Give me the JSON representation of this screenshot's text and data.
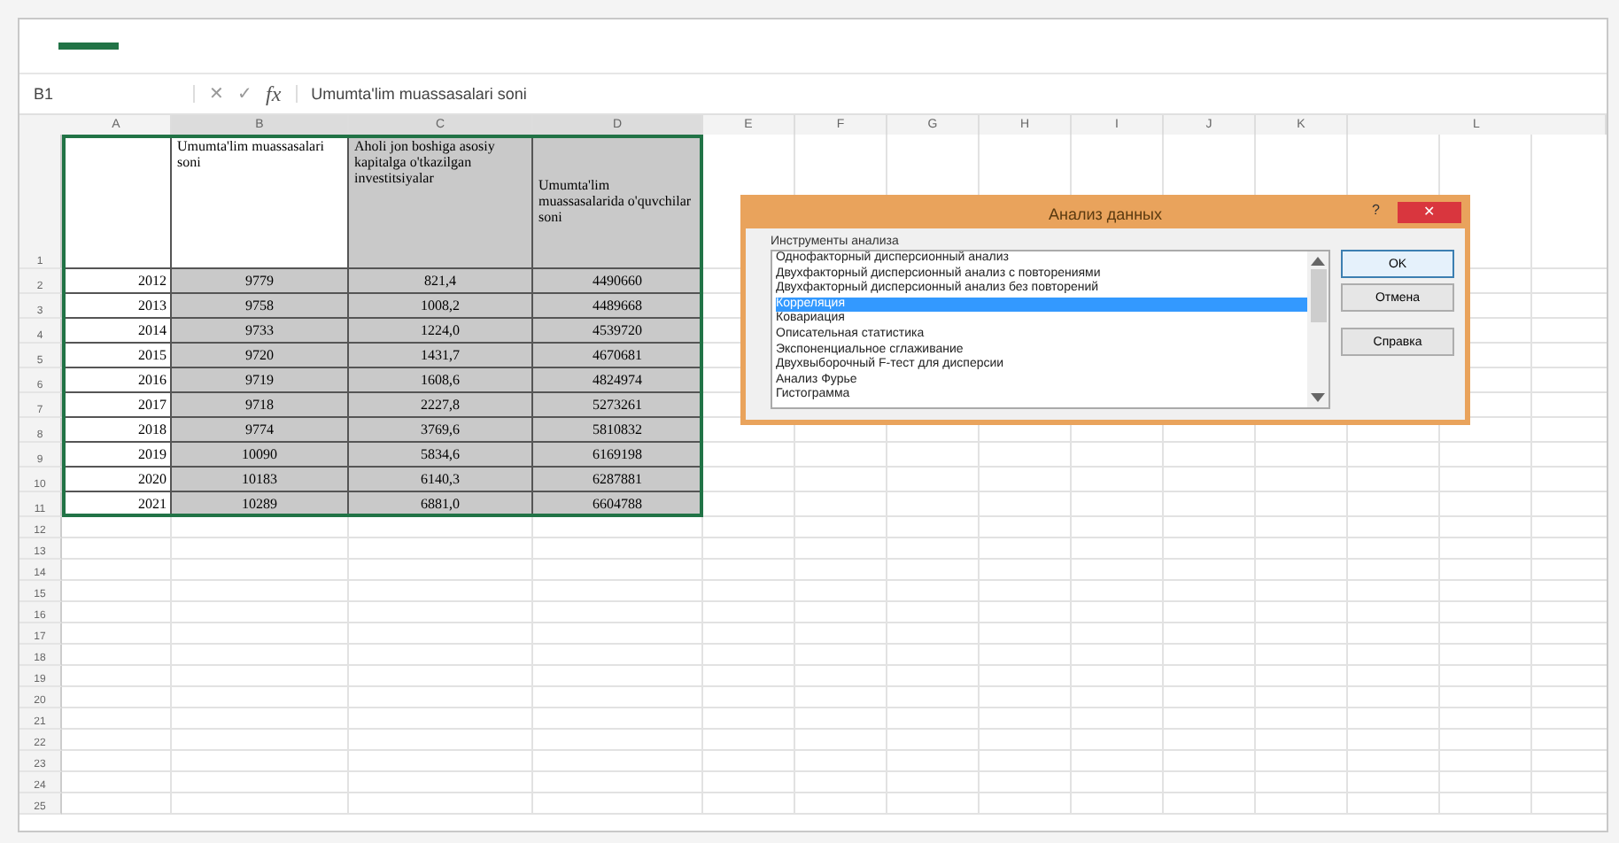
{
  "formula_bar": {
    "name_box": "B1",
    "cancel": "✕",
    "enter": "✓",
    "fx": "fx",
    "formula": "Umumta'lim muassasalari soni"
  },
  "columns": [
    "A",
    "B",
    "C",
    "D",
    "E",
    "F",
    "G",
    "H",
    "I",
    "J",
    "K",
    "L"
  ],
  "header_row": {
    "row": "1",
    "headers": [
      "Umumta'lim muassasalari soni",
      "Aholi jon boshiga asosiy kapitalga o'tkazilgan investitsiyalar",
      "Umumta'lim muassasalarida o'quvchilar soni"
    ]
  },
  "rows": [
    {
      "row": "2",
      "year": "2012",
      "values": [
        "9779",
        "821,4",
        "4490660"
      ]
    },
    {
      "row": "3",
      "year": "2013",
      "values": [
        "9758",
        "1008,2",
        "4489668"
      ]
    },
    {
      "row": "4",
      "year": "2014",
      "values": [
        "9733",
        "1224,0",
        "4539720"
      ]
    },
    {
      "row": "5",
      "year": "2015",
      "values": [
        "9720",
        "1431,7",
        "4670681"
      ]
    },
    {
      "row": "6",
      "year": "2016",
      "values": [
        "9719",
        "1608,6",
        "4824974"
      ]
    },
    {
      "row": "7",
      "year": "2017",
      "values": [
        "9718",
        "2227,8",
        "5273261"
      ]
    },
    {
      "row": "8",
      "year": "2018",
      "values": [
        "9774",
        "3769,6",
        "5810832"
      ]
    },
    {
      "row": "9",
      "year": "2019",
      "values": [
        "10090",
        "5834,6",
        "6169198"
      ]
    },
    {
      "row": "10",
      "year": "2020",
      "values": [
        "10183",
        "6140,3",
        "6287881"
      ]
    },
    {
      "row": "11",
      "year": "2021",
      "values": [
        "10289",
        "6881,0",
        "6604788"
      ]
    }
  ],
  "empty_rows": [
    "12",
    "13",
    "14",
    "15",
    "16",
    "17",
    "18",
    "19",
    "20",
    "21",
    "22",
    "23",
    "24",
    "25"
  ],
  "dialog": {
    "title": "Анализ данных",
    "help": "?",
    "close": "✕",
    "group_label": "Инструменты анализа",
    "tools": [
      {
        "label": "Однофакторный дисперсионный анализ",
        "selected": false
      },
      {
        "label": "Двухфакторный дисперсионный анализ с повторениями",
        "selected": false
      },
      {
        "label": "Двухфакторный дисперсионный анализ без повторений",
        "selected": false
      },
      {
        "label": "Корреляция",
        "selected": true
      },
      {
        "label": "Ковариация",
        "selected": false
      },
      {
        "label": "Описательная статистика",
        "selected": false
      },
      {
        "label": "Экспоненциальное сглаживание",
        "selected": false
      },
      {
        "label": "Двухвыборочный F-тест для дисперсии",
        "selected": false
      },
      {
        "label": "Анализ Фурье",
        "selected": false
      },
      {
        "label": "Гистограмма",
        "selected": false
      }
    ],
    "buttons": [
      {
        "label": "OK",
        "default": true
      },
      {
        "label": "Отмена",
        "default": false
      },
      {
        "label": "Справка",
        "default": false
      }
    ]
  }
}
